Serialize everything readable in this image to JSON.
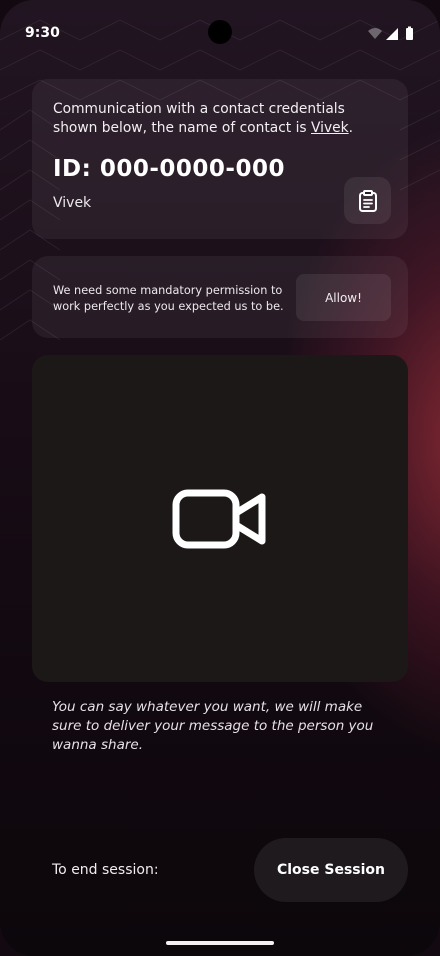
{
  "status_bar": {
    "time": "9:30",
    "icons": [
      "wifi-icon",
      "cellular-signal-icon",
      "battery-icon"
    ]
  },
  "credentials_card": {
    "description_prefix": "Communication with a contact credentials shown below,  the name of contact is ",
    "contact_link": "Vivek",
    "description_suffix": ".",
    "id_text": "ID: 000-0000-000",
    "contact_name": "Vivek",
    "copy_icon": "clipboard-icon"
  },
  "permission_card": {
    "message": "We need some mandatory permission to work perfectly as you expected us to be.",
    "allow_label": "Allow!"
  },
  "video_panel": {
    "icon": "video-camera-icon"
  },
  "note": "You can say whatever you want, we will make sure to deliver your message to the person you wanna share.",
  "footer": {
    "end_label": "To end session:",
    "close_label": "Close Session"
  },
  "colors": {
    "background": "#140a12",
    "accent_glow": "#962d37",
    "card": "#2a2028",
    "video_panel": "#1c1817",
    "button_dark": "#1e1a1e"
  }
}
